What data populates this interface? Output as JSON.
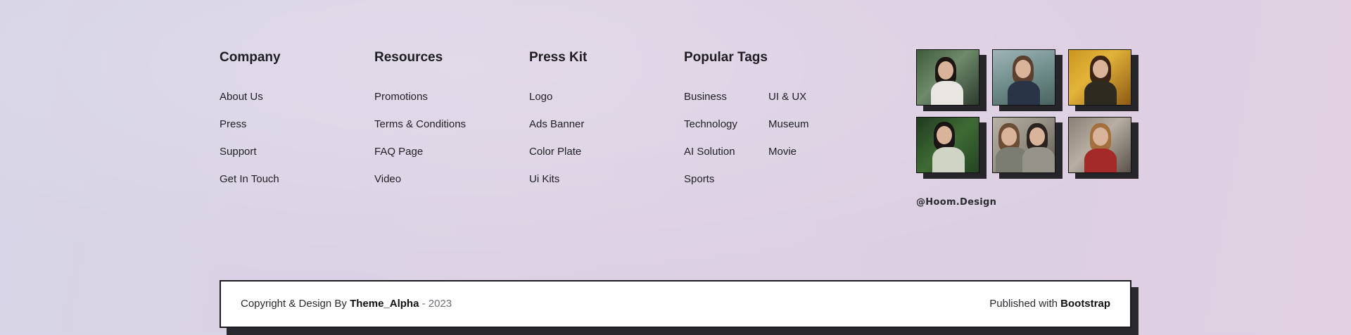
{
  "columns": {
    "company": {
      "title": "Company",
      "links": [
        "About Us",
        "Press",
        "Support",
        "Get In Touch"
      ]
    },
    "resources": {
      "title": "Resources",
      "links": [
        "Promotions",
        "Terms & Conditions",
        "FAQ Page",
        "Video"
      ]
    },
    "press_kit": {
      "title": "Press Kit",
      "links": [
        "Logo",
        "Ads Banner",
        "Color Plate",
        "Ui Kits"
      ]
    },
    "popular_tags": {
      "title": "Popular Tags",
      "tags": [
        "Business",
        "UI & UX",
        "Technology",
        "Museum",
        "AI Solution",
        "Movie",
        "Sports"
      ]
    }
  },
  "gallery": {
    "handle": "@Hoom.Design",
    "images": [
      {
        "name": "photo-woman-dark-hair-cafe"
      },
      {
        "name": "photo-woman-navy-sweater"
      },
      {
        "name": "photo-woman-autumn-leaves"
      },
      {
        "name": "photo-woman-floral-dress-park"
      },
      {
        "name": "photo-couple-sitting"
      },
      {
        "name": "photo-woman-red-scarf"
      }
    ]
  },
  "copyright": {
    "prefix": "Copyright & Design By",
    "brand": "Theme_Alpha",
    "separator": " - ",
    "year": "2023",
    "published_prefix": "Published with",
    "published_brand": "Bootstrap"
  },
  "colors": {
    "background": "#d9d2e4",
    "text": "#1f1f24",
    "shadow": "#2a2a2e",
    "box": "#ffffff"
  }
}
